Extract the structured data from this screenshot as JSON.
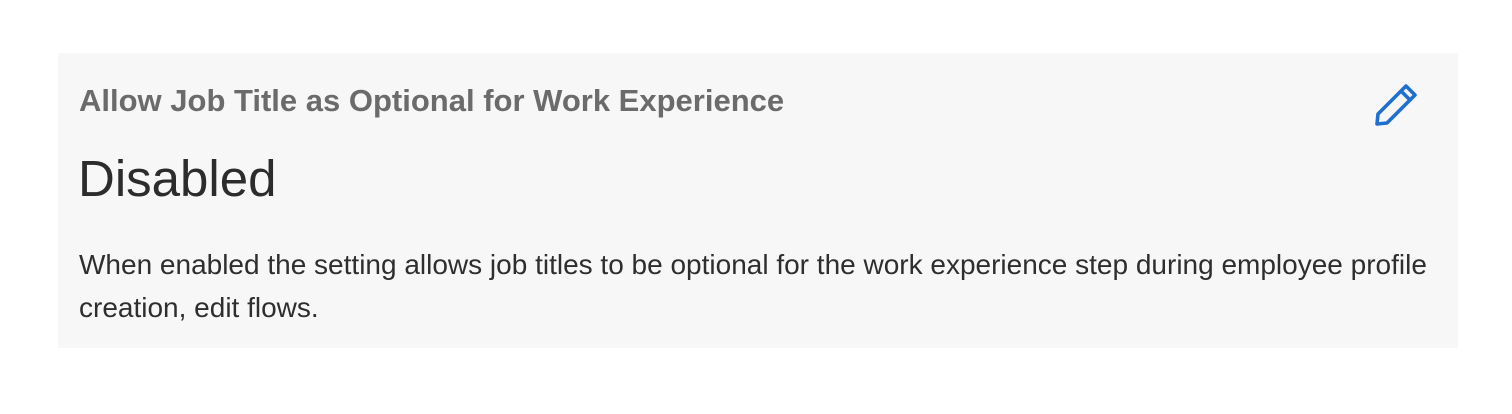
{
  "setting": {
    "title": "Allow Job Title as Optional for Work Experience",
    "value": "Disabled",
    "description": "When enabled the setting allows job titles to be optional for the work experience step during employee profile creation, edit flows.",
    "edit_icon": "pencil-icon"
  },
  "colors": {
    "card_background": "#f7f7f7",
    "title": "#6b6b6b",
    "value": "#2c2c2c",
    "description": "#2e2e2e",
    "accent": "#1f6fd1"
  }
}
